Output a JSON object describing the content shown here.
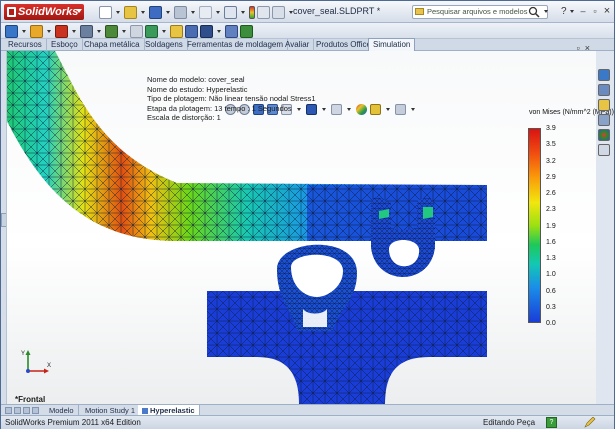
{
  "app": {
    "brand": "SolidWorks",
    "window_title": "cover_seal.SLDPRT *",
    "search_placeholder": "Pesquisar arquivos e modelos",
    "help_label": "?",
    "minimize": "–",
    "restore": "▫",
    "close": "×"
  },
  "tabs": [
    {
      "label": "Recursos"
    },
    {
      "label": "Esboço"
    },
    {
      "label": "Chapa metálica"
    },
    {
      "label": "Soldagens"
    },
    {
      "label": "Ferramentas de moldagem"
    },
    {
      "label": "Avaliar"
    },
    {
      "label": "Produtos Office"
    },
    {
      "label": "Simulation",
      "active": true
    }
  ],
  "mdi": {
    "minimize": "_",
    "restore": "▫",
    "close": "×"
  },
  "study_info": {
    "model_name": "Nome do modelo: cover_seal",
    "study_name": "Nome do estudo: Hyperelastic",
    "plot_type": "Tipo de plotagem: Não linear tensão nodal Stress1",
    "plot_step": "Etapa da plotagem: 13   tempo : 1 Segundos",
    "distortion": "Escala de distorção: 1"
  },
  "legend": {
    "title": "von Mises (N/mm^2 (MPa))",
    "labels": [
      "3.9",
      "3.5",
      "3.2",
      "2.9",
      "2.6",
      "2.3",
      "1.9",
      "1.6",
      "1.3",
      "1.0",
      "0.6",
      "0.3",
      "0.0"
    ]
  },
  "view": {
    "label": "*Frontal",
    "axis_y": "Y",
    "axis_x": "X"
  },
  "bottom_tabs": [
    {
      "label": "Modelo"
    },
    {
      "label": "Motion Study 1"
    },
    {
      "label": "Hyperelastic",
      "active": true
    }
  ],
  "status": {
    "edition": "SolidWorks Premium 2011 x64 Edition",
    "mode": "Editando Peça",
    "help": "?"
  },
  "colors": {
    "accent_red": "#c8231b",
    "titlebar": "#d5dde9",
    "mesh_blue": "#1a3dd8"
  }
}
